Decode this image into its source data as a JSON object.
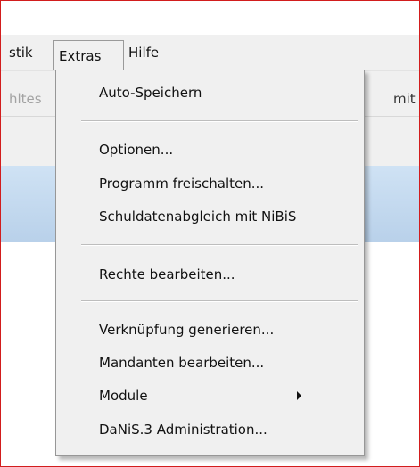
{
  "menubar": {
    "items": [
      {
        "label": "stik"
      },
      {
        "label": "Extras"
      },
      {
        "label": "Hilfe"
      }
    ]
  },
  "toolbar": {
    "left_text": "hltes",
    "right_text": "mit"
  },
  "menu": {
    "items": [
      {
        "label": "Auto-Speichern"
      },
      {
        "label": "Optionen..."
      },
      {
        "label": "Programm freischalten..."
      },
      {
        "label": "Schuldatenabgleich mit NiBiS"
      },
      {
        "label": "Rechte bearbeiten..."
      },
      {
        "label": "Verknüpfung generieren..."
      },
      {
        "label": "Mandanten bearbeiten..."
      },
      {
        "label": "Module"
      },
      {
        "label": "DaNiS.3 Administration..."
      }
    ]
  },
  "colors": {
    "frame_border": "#d21d1d",
    "menu_bg": "#f0f0f0",
    "strip_blue": "#c4d9ef"
  }
}
